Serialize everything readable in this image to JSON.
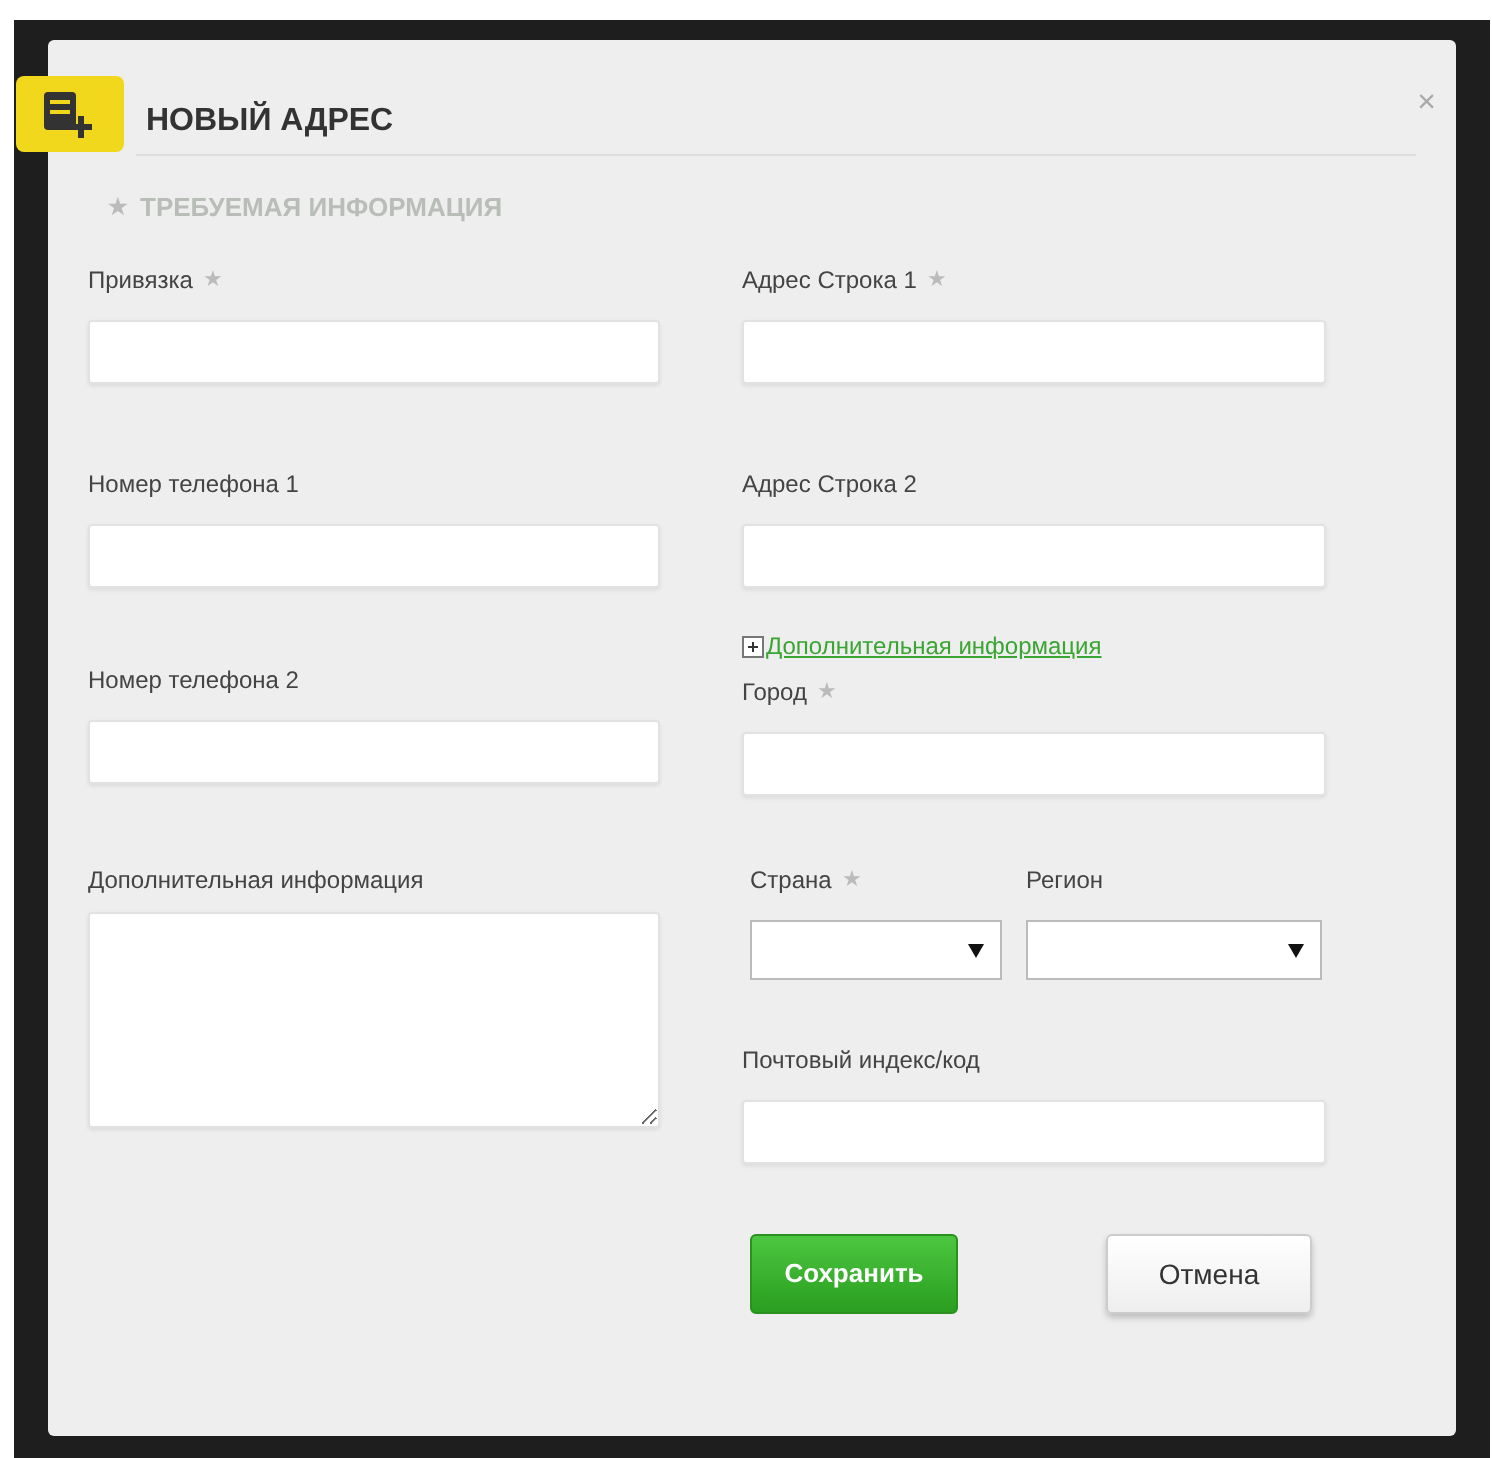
{
  "dialog": {
    "title": "НОВЫЙ АДРЕС",
    "close": "×",
    "required_note": "ТРЕБУЕМАЯ ИНФОРМАЦИЯ",
    "required_mark": "★"
  },
  "left_fields": [
    {
      "kind": "text",
      "label": "Привязка",
      "required": true
    },
    {
      "kind": "text",
      "label": "Номер телефона 1",
      "required": false
    },
    {
      "kind": "text",
      "label": "Номер телефона 2",
      "required": false
    },
    {
      "kind": "textarea",
      "label": "Дополнительная информация",
      "required": false
    }
  ],
  "right_fields": [
    {
      "kind": "text",
      "label": "Адрес Строка 1",
      "required": true
    },
    {
      "kind": "text",
      "label": "Адрес Строка 2",
      "required": false
    },
    {
      "kind": "link",
      "label": "Дополнительная информация"
    },
    {
      "kind": "text",
      "label": "Город",
      "required": true
    },
    {
      "kind": "selects",
      "items": [
        {
          "label": "Страна",
          "required": true
        },
        {
          "label": "Регион",
          "required": false
        }
      ]
    },
    {
      "kind": "text",
      "label": "Почтовый индекс/код",
      "required": false
    }
  ],
  "buttons": [
    {
      "kind": "primary",
      "label": "Сохранить"
    },
    {
      "kind": "secondary",
      "label": "Отмена"
    }
  ]
}
